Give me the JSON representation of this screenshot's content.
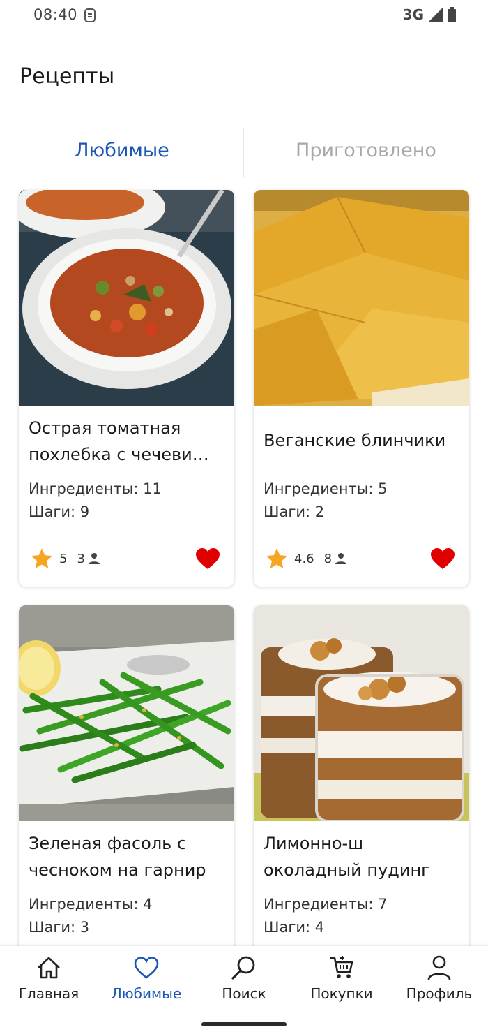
{
  "status_bar": {
    "time": "08:40",
    "network": "3G"
  },
  "app": {
    "title": "Рецепты"
  },
  "tabs": [
    {
      "label": "Любимые",
      "active": true
    },
    {
      "label": "Приготовлено",
      "active": false
    }
  ],
  "recipes": [
    {
      "title": "Острая томатная похлебка с чечеви…",
      "ingredients": "Ингредиенты: 11",
      "steps": "Шаги: 9",
      "rating": "5",
      "votes": "3",
      "favorite": true
    },
    {
      "title": "Веганские блинчики",
      "ingredients": "Ингредиенты: 5",
      "steps": "Шаги: 2",
      "rating": "4.6",
      "votes": "8",
      "favorite": true
    },
    {
      "title": "Зеленая фасоль с чесноком на гарнир",
      "ingredients": "Ингредиенты: 4",
      "steps": "Шаги: 3"
    },
    {
      "title": "Лимонно-ш околадный пудинг",
      "ingredients": "Ингредиенты: 7",
      "steps": "Шаги: 4"
    }
  ],
  "bottom_nav": [
    {
      "label": "Главная",
      "icon": "home-icon"
    },
    {
      "label": "Любимые",
      "icon": "heart-outline-icon",
      "active": true
    },
    {
      "label": "Поиск",
      "icon": "search-icon"
    },
    {
      "label": "Покупки",
      "icon": "cart-icon"
    },
    {
      "label": "Профиль",
      "icon": "profile-icon"
    }
  ],
  "colors": {
    "accent": "#1b56b5",
    "inactive_tab": "#a8a8a8",
    "star": "#f5a623",
    "heart": "#e00000"
  }
}
